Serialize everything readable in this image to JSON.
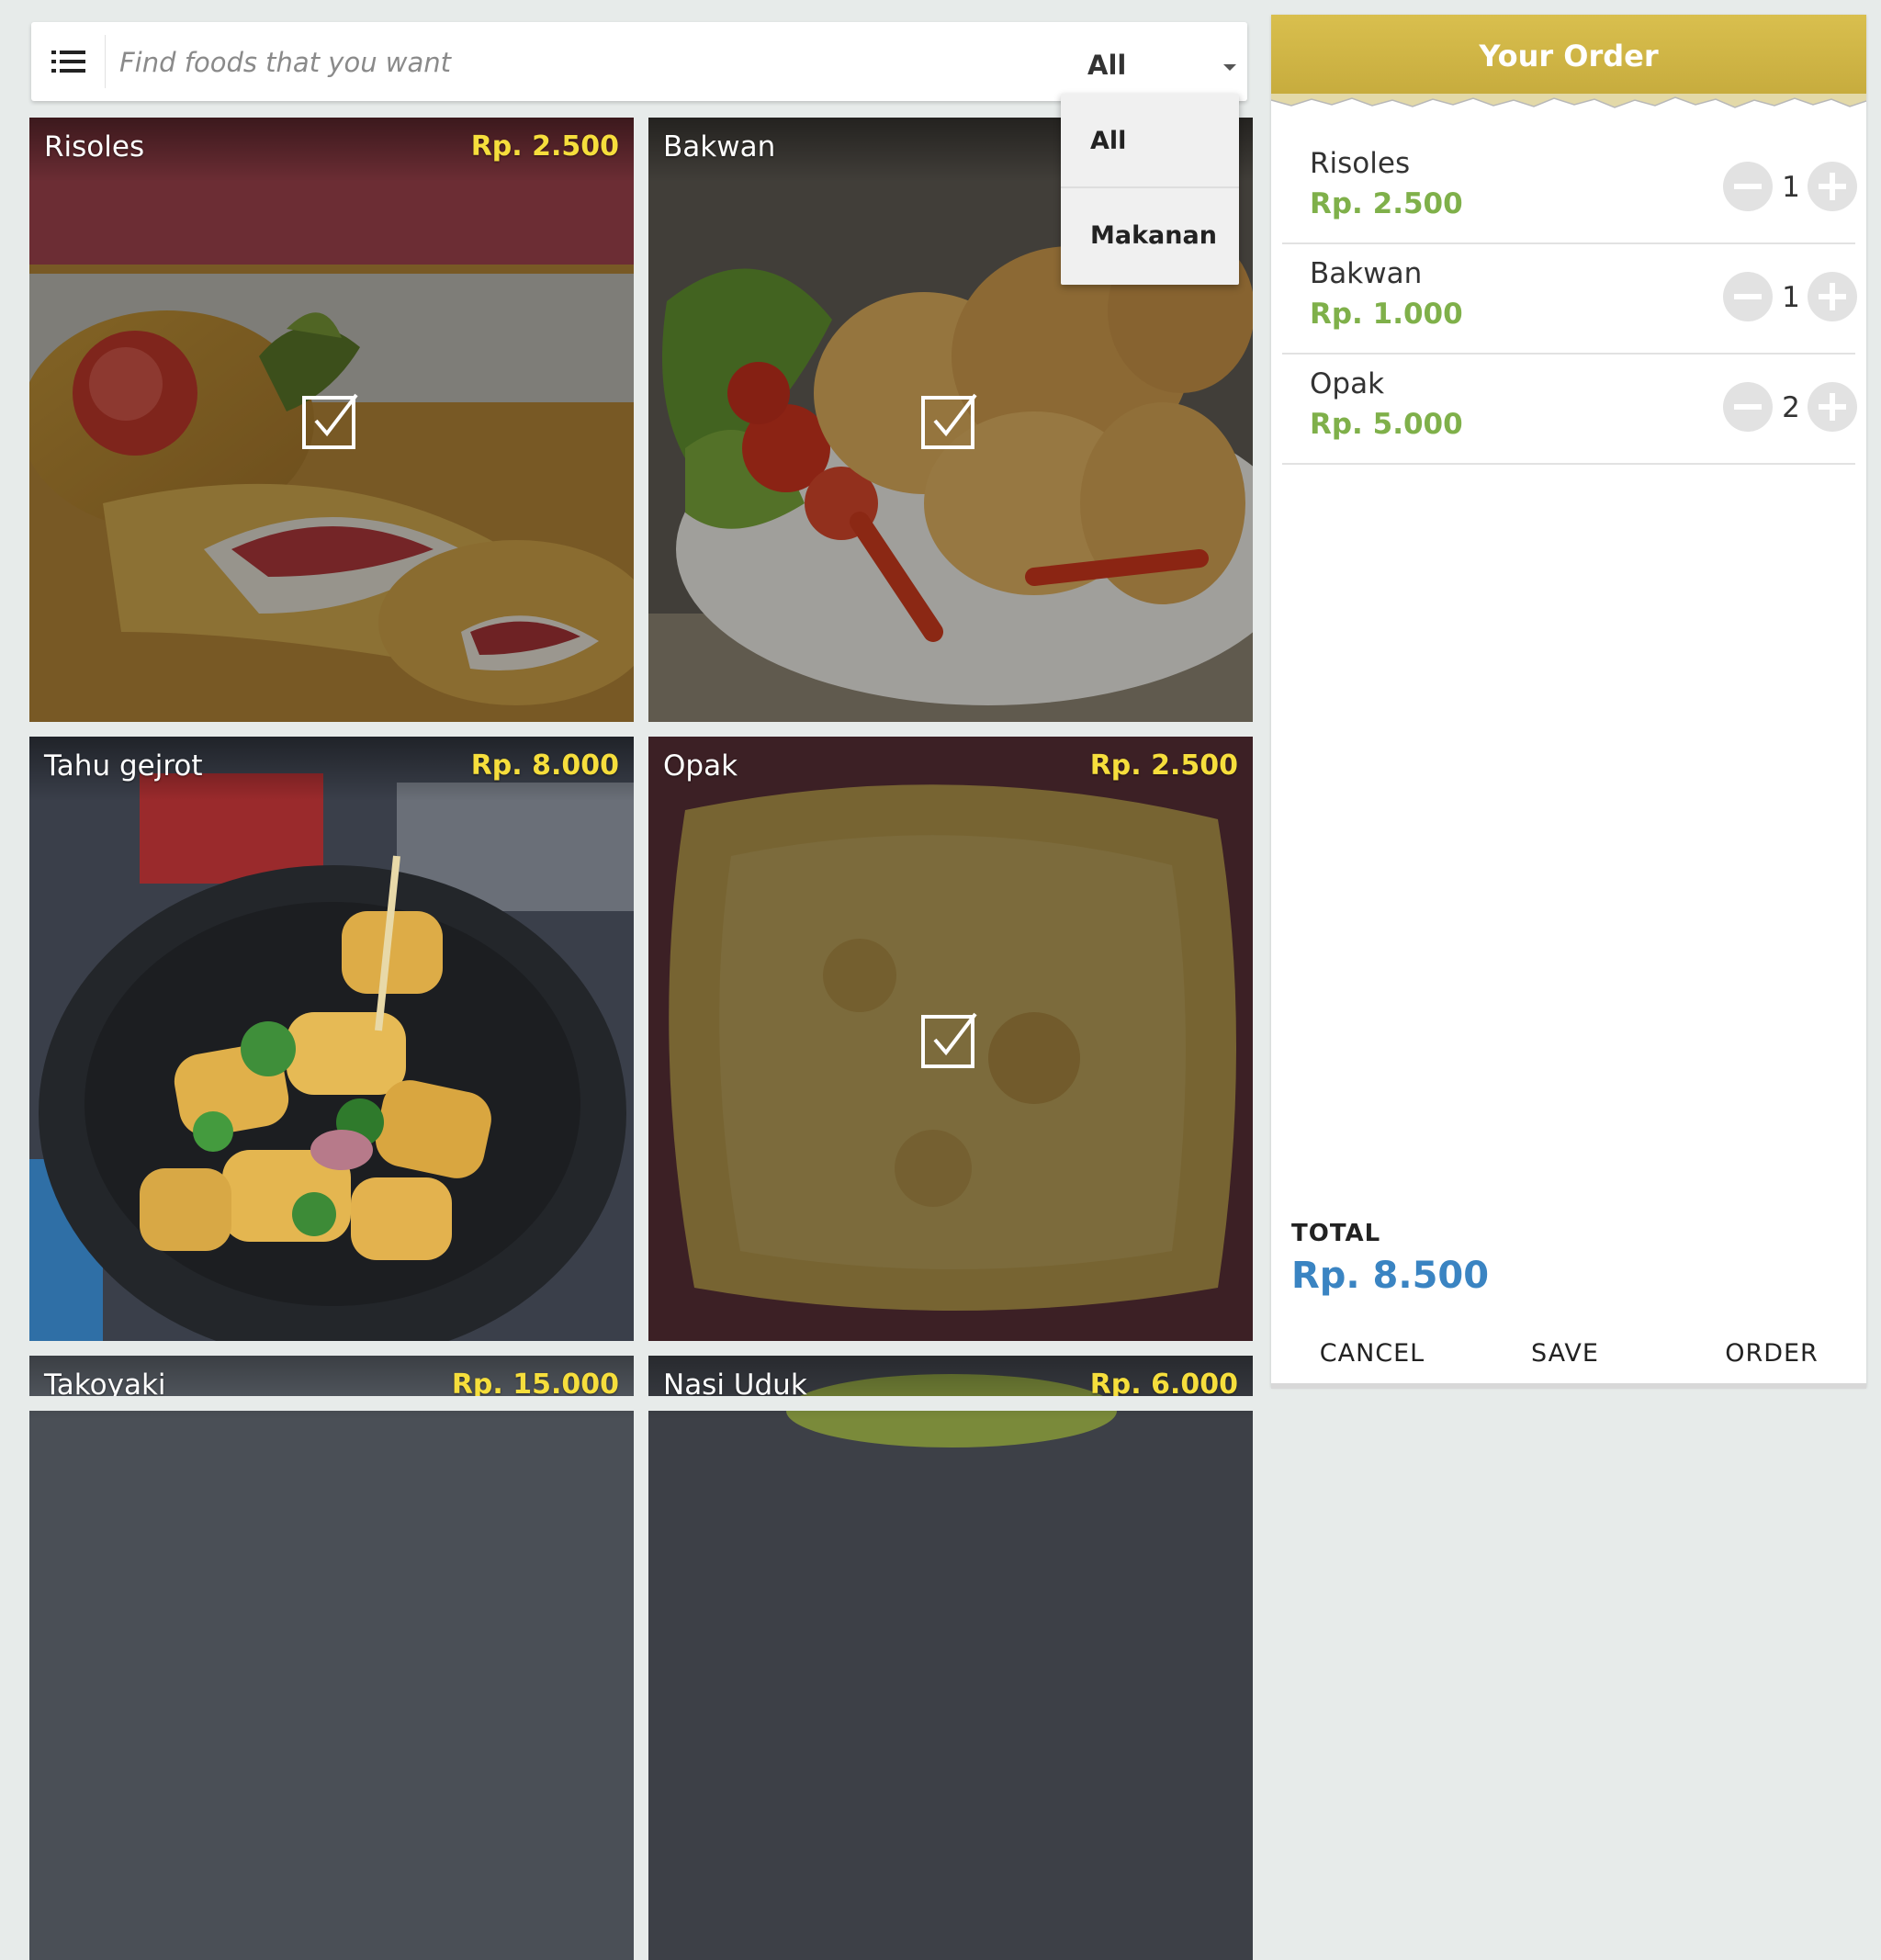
{
  "search": {
    "placeholder": "Find foods that you want",
    "filter_value": "All",
    "filter_options": [
      "All",
      "Makanan"
    ]
  },
  "foods": [
    {
      "name": "Risoles",
      "price": "Rp. 2.500",
      "selected": true
    },
    {
      "name": "Bakwan",
      "price": "",
      "selected": true
    },
    {
      "name": "Tahu gejrot",
      "price": "Rp. 8.000",
      "selected": false
    },
    {
      "name": "Opak",
      "price": "Rp. 2.500",
      "selected": true
    },
    {
      "name": "Takoyaki",
      "price": "Rp. 15.000",
      "selected": false
    },
    {
      "name": "Nasi Uduk",
      "price": "Rp. 6.000",
      "selected": false
    }
  ],
  "order": {
    "title": "Your Order",
    "items": [
      {
        "name": "Risoles",
        "price": "Rp. 2.500",
        "qty": "1"
      },
      {
        "name": "Bakwan",
        "price": "Rp. 1.000",
        "qty": "1"
      },
      {
        "name": "Opak",
        "price": "Rp. 5.000",
        "qty": "2"
      }
    ],
    "total_label": "TOTAL",
    "total_value": "Rp. 8.500",
    "buttons": {
      "cancel": "CANCEL",
      "save": "SAVE",
      "order": "ORDER"
    }
  },
  "colors": {
    "header_gold": "#c9ae40",
    "price_yellow": "#f6de3c",
    "price_green": "#7fb04a",
    "total_blue": "#3a84c2",
    "background": "#e7ebea"
  }
}
